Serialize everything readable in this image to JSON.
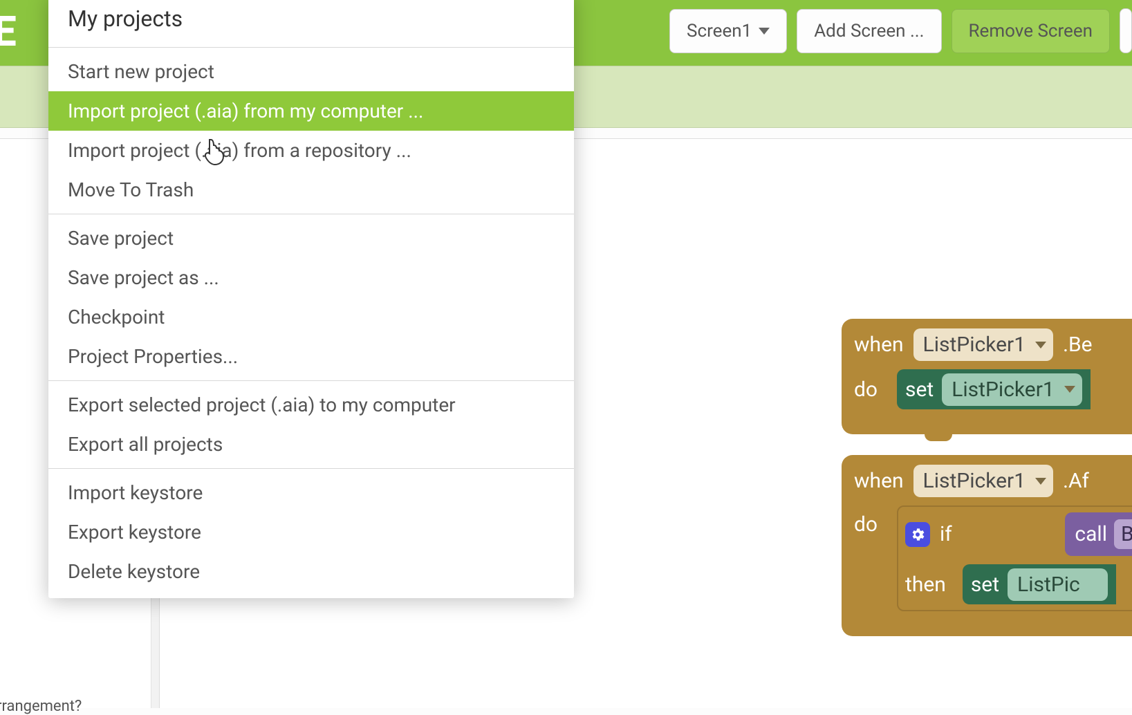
{
  "toolbar": {
    "logo_fragment": "E",
    "screen_button": "Screen1",
    "add_screen": "Add Screen ...",
    "remove_screen": "Remove Screen"
  },
  "menu": {
    "header": "My projects",
    "groups": [
      [
        "Start new project",
        "Import project (.aia) from my computer ...",
        "Import project (.aia) from a repository ...",
        "Move To Trash"
      ],
      [
        "Save project",
        "Save project as ...",
        "Checkpoint",
        "Project Properties..."
      ],
      [
        "Export selected project (.aia) to my computer",
        "Export all projects"
      ],
      [
        "Import keystore",
        "Export keystore",
        "Delete keystore"
      ]
    ],
    "hovered": "Import project (.aia) from my computer ..."
  },
  "blocks": {
    "event1": {
      "when": "when",
      "component": "ListPicker1",
      "event_suffix": ".Be",
      "do": "do",
      "set": "set",
      "set_target": "ListPicker1"
    },
    "event2": {
      "when": "when",
      "component": "ListPicker1",
      "event_suffix": ".Af",
      "do": "do",
      "if": "if",
      "call": "call",
      "call_target": "Bl",
      "then": "then",
      "set": "set",
      "set_target": "ListPic"
    }
  },
  "sidebar": {
    "fragment": "rrangement?"
  }
}
